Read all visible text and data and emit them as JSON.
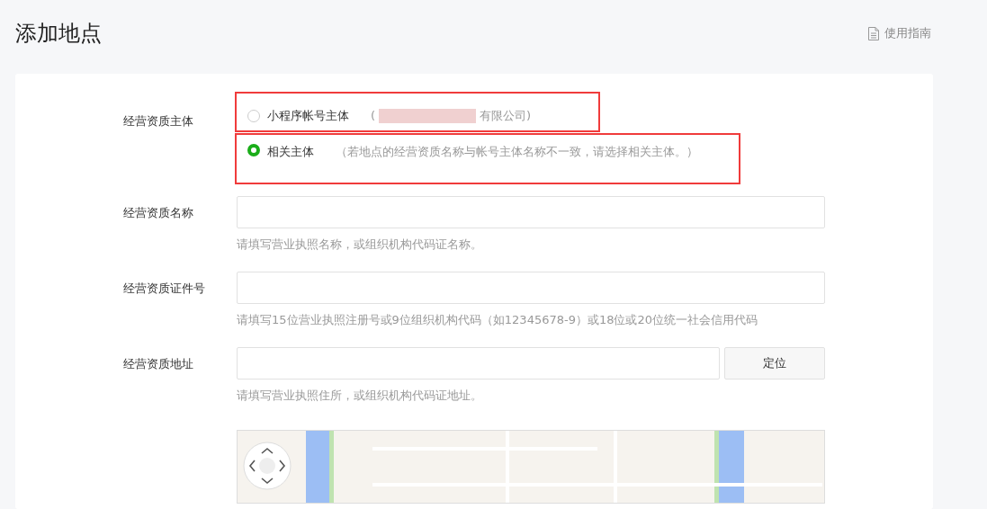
{
  "page": {
    "title": "添加地点",
    "guide_link": "使用指南"
  },
  "subject": {
    "label": "经营资质主体",
    "options": [
      {
        "kind": "account",
        "label": "小程序帐号主体",
        "note_open": "(",
        "note_redacted": true,
        "note_close": "有限公司)",
        "selected": false,
        "highlighted": true
      },
      {
        "kind": "related",
        "label": "相关主体",
        "note_open": "（若地点的经营资质名称与帐号主体名称不一致，请选择相关主体。）",
        "note_redacted": false,
        "selected": true,
        "highlighted": true
      }
    ]
  },
  "fields": [
    {
      "label": "经营资质名称",
      "hint": "请填写营业执照名称，或组织机构代码证名称。"
    },
    {
      "label": "经营资质证件号",
      "hint": "请填写15位营业执照注册号或9位组织机构代码（如12345678-9）或18位或20位统一社会信用代码"
    },
    {
      "label": "经营资质地址",
      "hint": "请填写营业执照住所，或组织机构代码证地址。",
      "button": "定位"
    }
  ],
  "map": {
    "shown": true
  }
}
